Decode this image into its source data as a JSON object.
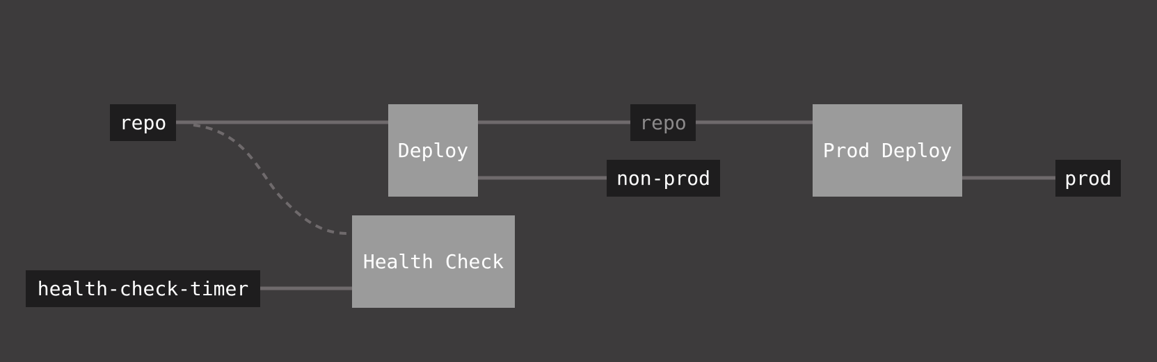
{
  "colors": {
    "background": "#3d3b3c",
    "resource_fill": "#1e1d1e",
    "job_fill": "#9b9b9b",
    "edge": "#6f6a6c",
    "text": "#ffffff",
    "dimmed_text": "#8c8a8b"
  },
  "resources": {
    "repo_input": "repo",
    "health_check_timer": "health-check-timer",
    "repo_passed": "repo",
    "non_prod": "non-prod",
    "prod": "prod"
  },
  "jobs": {
    "deploy": "Deploy",
    "health_check": "Health Check",
    "prod_deploy": "Prod Deploy"
  },
  "edges": [
    {
      "from": "repo",
      "to": "Deploy",
      "style": "solid"
    },
    {
      "from": "repo",
      "to": "Health Check",
      "style": "dashed"
    },
    {
      "from": "health-check-timer",
      "to": "Health Check",
      "style": "solid"
    },
    {
      "from": "Deploy",
      "to": "repo",
      "style": "solid"
    },
    {
      "from": "Deploy",
      "to": "non-prod",
      "style": "solid"
    },
    {
      "from": "repo",
      "to": "Prod Deploy",
      "style": "solid"
    },
    {
      "from": "Prod Deploy",
      "to": "prod",
      "style": "solid"
    }
  ]
}
